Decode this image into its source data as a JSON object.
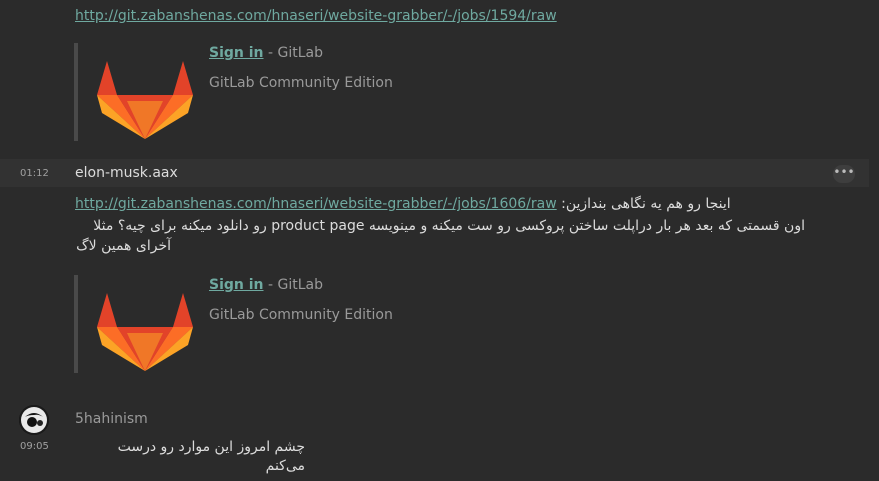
{
  "colors": {
    "background": "#2b2b2b",
    "link": "#6fa9a0",
    "gitlab_orange": "#e24329",
    "gitlab_light": "#fca326",
    "gitlab_mid": "#fc6d26"
  },
  "messages": [
    {
      "link": "http://git.zabanshenas.com/hnaseri/website-grabber/-/jobs/1594/raw",
      "preview": {
        "logo_icon": "gitlab-tanuki-icon",
        "sign_in": "Sign in",
        "site": "- GitLab",
        "description": "GitLab Community Edition"
      }
    },
    {
      "time": "01:12",
      "sender": "elon-musk.aax",
      "options_icon": "more-options-icon",
      "line1_link": "http://git.zabanshenas.com/hnaseri/website-grabber/-/jobs/1606/raw",
      "line1_text": "اینجا رو هم یه نگاهی بندازین:",
      "line2": "اون قسمتی که بعد هر بار دراپلت ساختن پروکسی رو ست میکنه و مینویسه product page رو دانلود میکنه برای چیه؟ مثلا",
      "line3": "آخرای همین لاگ",
      "preview": {
        "logo_icon": "gitlab-tanuki-icon",
        "sign_in": "Sign in",
        "site": "- GitLab",
        "description": "GitLab Community Edition"
      }
    },
    {
      "time": "09:05",
      "sender": "5hahinism",
      "text": "چشم امروز این موارد رو درست می‌کنم"
    }
  ]
}
